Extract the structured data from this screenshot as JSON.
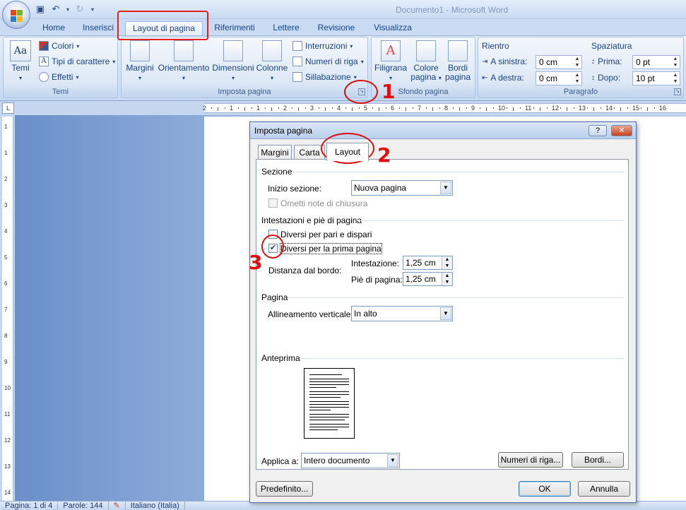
{
  "window": {
    "title": "Documento1 - Microsoft Word"
  },
  "ribbon_tabs": [
    {
      "label": "Home"
    },
    {
      "label": "Inserisci"
    },
    {
      "label": "Layout di pagina"
    },
    {
      "label": "Riferimenti"
    },
    {
      "label": "Lettere"
    },
    {
      "label": "Revisione"
    },
    {
      "label": "Visualizza"
    }
  ],
  "groups": {
    "temi": {
      "label": "Temi",
      "big": "Temi",
      "colori": "Colori",
      "tipi": "Tipi di carattere",
      "effetti": "Effetti"
    },
    "imposta": {
      "label": "Imposta pagina",
      "margini": "Margini",
      "orientamento": "Orientamento",
      "dimensioni": "Dimensioni",
      "colonne": "Colonne",
      "interruzioni": "Interruzioni",
      "numeri_riga": "Numeri di riga",
      "sillabazione": "Sillabazione"
    },
    "sfondo": {
      "label": "Sfondo pagina",
      "filigrana": "Filigrana",
      "colore1": "Colore",
      "colore2": "pagina",
      "bordi1": "Bordi",
      "bordi2": "pagina"
    },
    "paragrafo": {
      "label": "Paragrafo",
      "rientro": "Rientro",
      "sinistra_label": "A sinistra:",
      "sinistra_val": "0 cm",
      "destra_label": "A destra:",
      "destra_val": "0 cm",
      "spaziatura": "Spaziatura",
      "prima_label": "Prima:",
      "prima_val": "0 pt",
      "dopo_label": "Dopo:",
      "dopo_val": "10 pt"
    }
  },
  "ruler_numbers": [
    "2",
    "1",
    "1",
    "2",
    "3",
    "4",
    "5",
    "6",
    "7",
    "8",
    "9",
    "10",
    "11",
    "12",
    "13",
    "14",
    "15",
    "16"
  ],
  "vruler_numbers": [
    "1",
    "1",
    "2",
    "3",
    "4",
    "5",
    "6",
    "7",
    "8",
    "9",
    "10",
    "11",
    "12",
    "13",
    "14"
  ],
  "statusbar": {
    "pagina": "Pagina: 1 di 4",
    "parole": "Parole: 144",
    "lingua": "Italiano (Italia)"
  },
  "dialog": {
    "title": "Imposta pagina",
    "help": "?",
    "close": "✕",
    "tabs": [
      "Margini",
      "Carta",
      "Layout"
    ],
    "sezione": {
      "title": "Sezione",
      "inizio_label": "Inizio sezione:",
      "inizio_value": "Nuova pagina",
      "ometti": "Ometti note di chiusura"
    },
    "intestazioni": {
      "title": "Intestazioni e piè di pagina",
      "diversi_pari": "Diversi per pari e dispari",
      "diversi_prima": "Diversi per la prima pagina",
      "distanza_label": "Distanza dal bordo:",
      "intestazione_label": "Intestazione:",
      "intestazione_value": "1,25 cm",
      "pie_label": "Piè di pagina:",
      "pie_value": "1,25 cm"
    },
    "pagina": {
      "title": "Pagina",
      "allineamento_label": "Allineamento verticale:",
      "allineamento_value": "In alto"
    },
    "anteprima": {
      "title": "Anteprima",
      "applica_label": "Applica a:",
      "applica_value": "Intero documento",
      "numeri_riga": "Numeri di riga...",
      "bordi": "Bordi..."
    },
    "predefinito": "Predefinito...",
    "ok": "OK",
    "annulla": "Annulla"
  },
  "annotations": {
    "n1": "1",
    "n2": "2",
    "n3": "3",
    "color": "#e01010"
  }
}
